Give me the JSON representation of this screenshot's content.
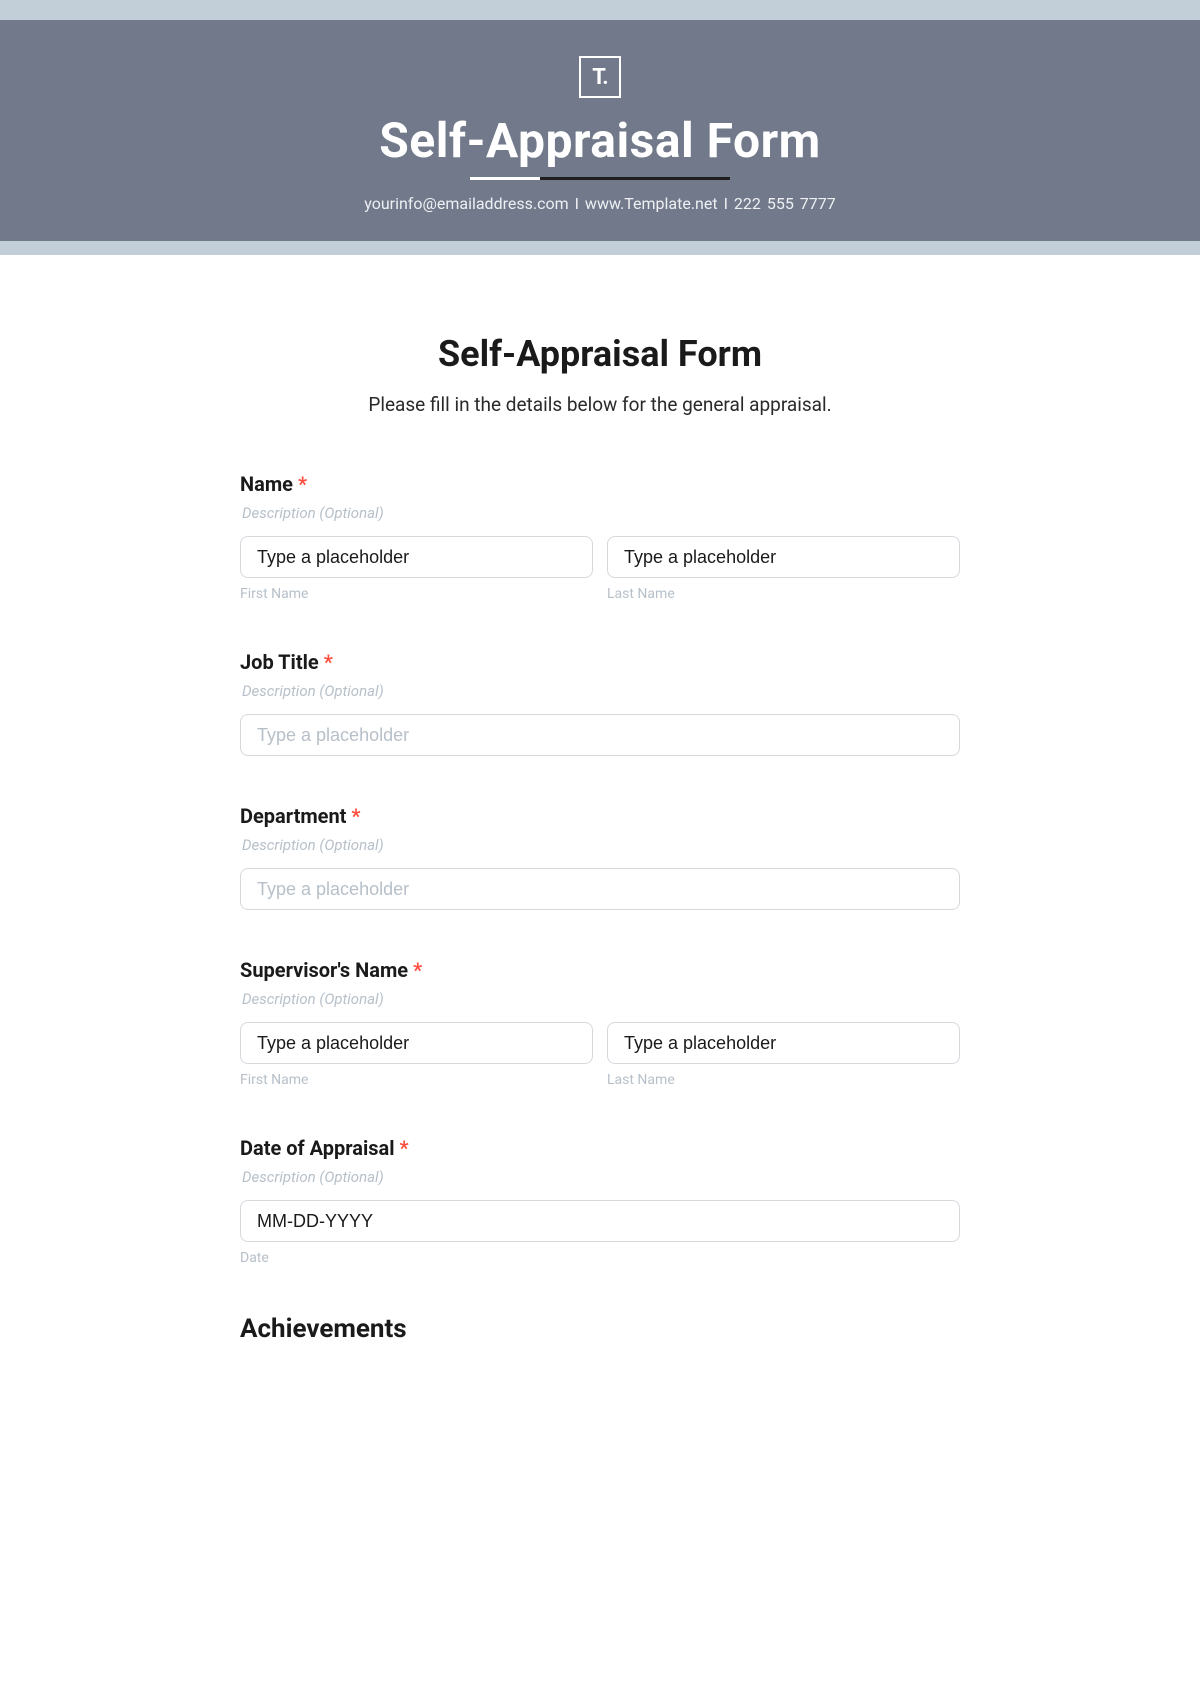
{
  "banner": {
    "logo_text": "T.",
    "title": "Self-Appraisal Form",
    "contact_line": "yourinfo@emailaddress.com  I  www.Template.net  I  222 555 7777"
  },
  "form": {
    "title": "Self-Appraisal Form",
    "subtitle": "Please fill in the details below for the general appraisal.",
    "fields": {
      "name": {
        "label": "Name",
        "description": "Description (Optional)",
        "first_placeholder": "Type a placeholder",
        "last_placeholder": "Type a placeholder",
        "first_sublabel": "First Name",
        "last_sublabel": "Last Name"
      },
      "job_title": {
        "label": "Job Title",
        "description": "Description (Optional)",
        "placeholder": "Type a placeholder"
      },
      "department": {
        "label": "Department",
        "description": "Description (Optional)",
        "placeholder": "Type a placeholder"
      },
      "supervisor": {
        "label": "Supervisor's Name",
        "description": "Description (Optional)",
        "first_placeholder": "Type a placeholder",
        "last_placeholder": "Type a placeholder",
        "first_sublabel": "First Name",
        "last_sublabel": "Last Name"
      },
      "appraisal_date": {
        "label": "Date of Appraisal",
        "description": "Description (Optional)",
        "placeholder": "MM-DD-YYYY",
        "sublabel": "Date"
      }
    },
    "sections": {
      "achievements": "Achievements"
    },
    "required_marker": "*"
  }
}
